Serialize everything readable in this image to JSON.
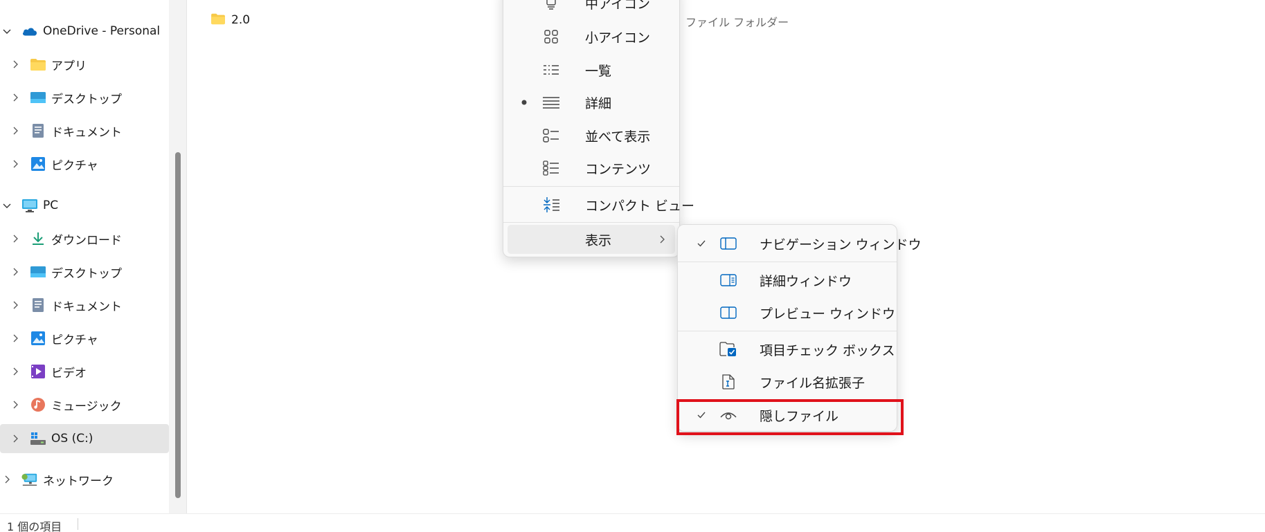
{
  "sidebar": {
    "items": [
      {
        "label": "OneDrive - Personal",
        "icon": "onedrive-cloud-icon",
        "expanded": true
      },
      {
        "label": "アプリ",
        "icon": "folder-icon"
      },
      {
        "label": "デスクトップ",
        "icon": "desktop-icon"
      },
      {
        "label": "ドキュメント",
        "icon": "documents-icon"
      },
      {
        "label": "ピクチャ",
        "icon": "pictures-icon"
      },
      {
        "label": "PC",
        "icon": "pc-icon",
        "expanded": true
      },
      {
        "label": "ダウンロード",
        "icon": "download-icon"
      },
      {
        "label": "デスクトップ",
        "icon": "desktop-icon"
      },
      {
        "label": "ドキュメント",
        "icon": "documents-icon"
      },
      {
        "label": "ピクチャ",
        "icon": "pictures-icon"
      },
      {
        "label": "ビデオ",
        "icon": "videos-icon"
      },
      {
        "label": "ミュージック",
        "icon": "music-icon"
      },
      {
        "label": "OS (C:)",
        "icon": "drive-icon",
        "selected": true
      },
      {
        "label": "ネットワーク",
        "icon": "network-icon"
      }
    ]
  },
  "main": {
    "files": [
      {
        "name": "2.0",
        "type": "ファイル フォルダー",
        "icon": "folder-icon"
      }
    ]
  },
  "layout_menu": {
    "items": [
      {
        "label": "中アイコン",
        "icon": "medium-icons-icon"
      },
      {
        "label": "小アイコン",
        "icon": "small-icons-icon"
      },
      {
        "label": "一覧",
        "icon": "list-view-icon"
      },
      {
        "label": "詳細",
        "icon": "details-view-icon",
        "selected": true
      },
      {
        "label": "並べて表示",
        "icon": "tiles-view-icon"
      },
      {
        "label": "コンテンツ",
        "icon": "content-view-icon"
      },
      {
        "label": "コンパクト ビュー",
        "icon": "compact-view-icon"
      },
      {
        "label": "表示",
        "icon": "chevron-right-icon"
      }
    ]
  },
  "show_submenu": {
    "items": [
      {
        "label": "ナビゲーション ウィンドウ",
        "icon": "navigation-pane-icon",
        "checked": true
      },
      {
        "label": "詳細ウィンドウ",
        "icon": "details-pane-icon",
        "checked": false
      },
      {
        "label": "プレビュー ウィンドウ",
        "icon": "preview-pane-icon",
        "checked": false
      },
      {
        "label": "項目チェック ボックス",
        "icon": "item-checkbox-icon",
        "checked": false
      },
      {
        "label": "ファイル名拡張子",
        "icon": "file-extension-icon",
        "checked": false
      },
      {
        "label": "隠しファイル",
        "icon": "hidden-files-eye-icon",
        "checked": true,
        "highlighted": true
      }
    ]
  },
  "status_bar": {
    "item_count": "1 個の項目"
  },
  "colors": {
    "highlight": "#e0121b",
    "accent": "#0067c0",
    "selected_bg": "#e5e5e5"
  }
}
